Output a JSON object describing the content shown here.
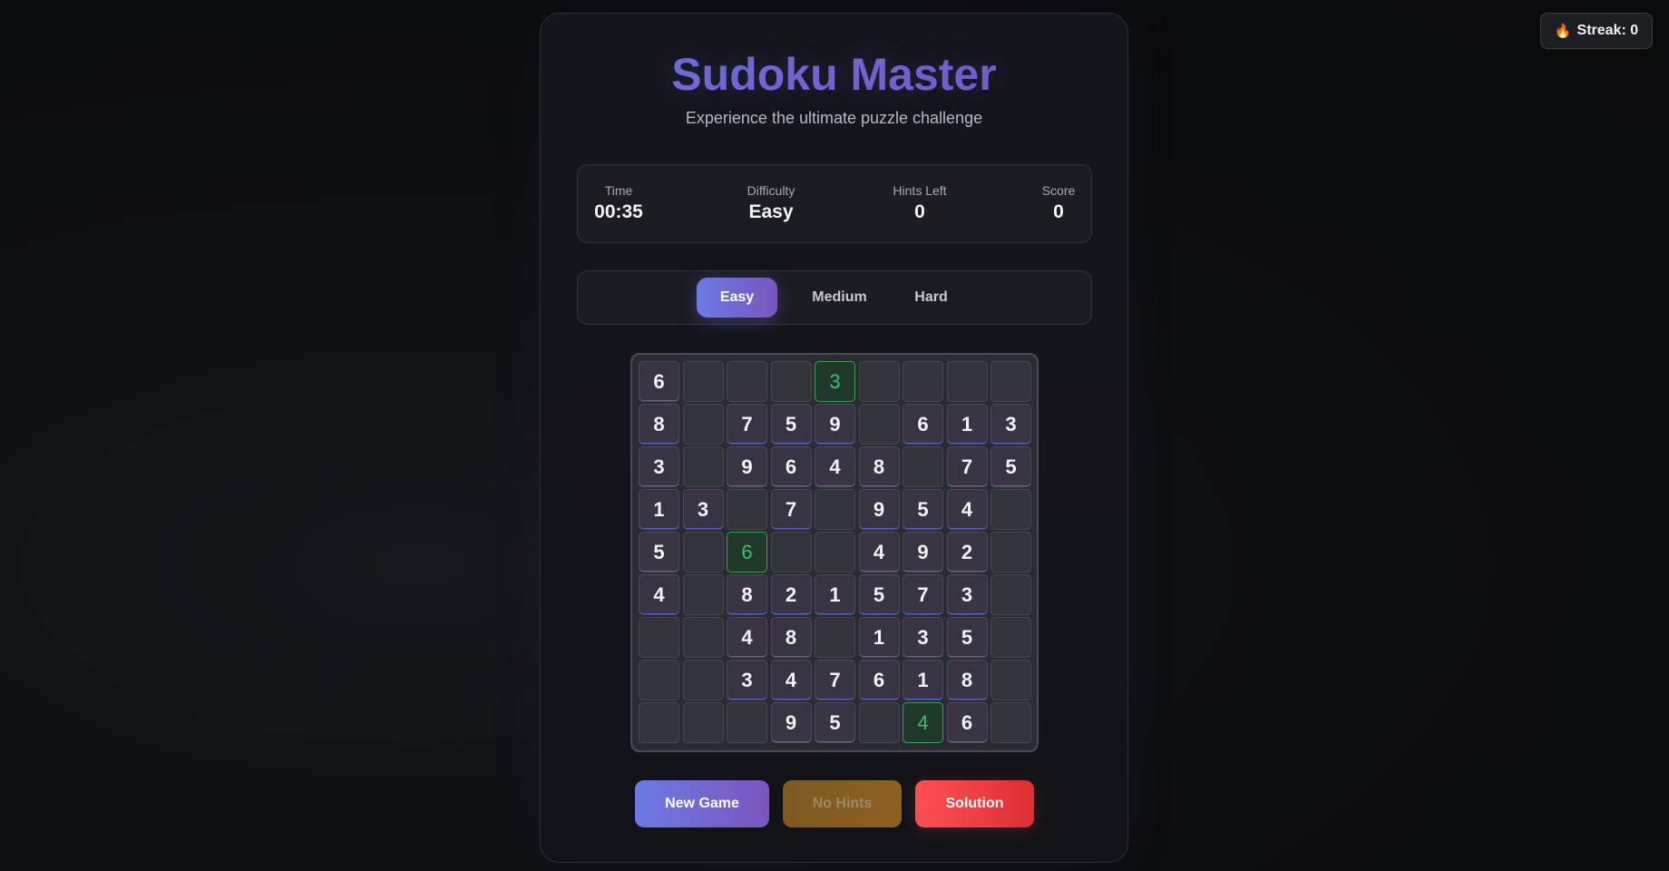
{
  "streak": {
    "icon": "flame-icon",
    "label": "Streak: 0"
  },
  "header": {
    "title": "Sudoku Master",
    "subtitle": "Experience the ultimate puzzle challenge"
  },
  "stats": [
    {
      "label": "Time",
      "value": "00:35"
    },
    {
      "label": "Difficulty",
      "value": "Easy"
    },
    {
      "label": "Hints Left",
      "value": "0"
    },
    {
      "label": "Score",
      "value": "0"
    }
  ],
  "difficulty_options": [
    {
      "label": "Easy",
      "selected": true
    },
    {
      "label": "Medium",
      "selected": false
    },
    {
      "label": "Hard",
      "selected": false
    }
  ],
  "board": {
    "rows": [
      [
        "6",
        "",
        "",
        "",
        "3",
        "",
        "",
        "",
        ""
      ],
      [
        "8",
        "",
        "7",
        "5",
        "9",
        "",
        "6",
        "1",
        "3"
      ],
      [
        "3",
        "",
        "9",
        "6",
        "4",
        "8",
        "",
        "7",
        "5"
      ],
      [
        "1",
        "3",
        "",
        "7",
        "",
        "9",
        "5",
        "4",
        ""
      ],
      [
        "5",
        "",
        "6",
        "",
        "",
        "4",
        "9",
        "2",
        ""
      ],
      [
        "4",
        "",
        "8",
        "2",
        "1",
        "5",
        "7",
        "3",
        ""
      ],
      [
        "",
        "",
        "4",
        "8",
        "",
        "1",
        "3",
        "5",
        ""
      ],
      [
        "",
        "",
        "3",
        "4",
        "7",
        "6",
        "1",
        "8",
        ""
      ],
      [
        "",
        "",
        "",
        "9",
        "5",
        "",
        "4",
        "6",
        ""
      ]
    ],
    "user_entered_cells": [
      [
        0,
        4
      ],
      [
        4,
        2
      ],
      [
        8,
        6
      ]
    ],
    "colors": {
      "given_bg": "#3a3344",
      "empty_bg": "#34353c",
      "user_text": "#3fbf6b"
    }
  },
  "actions": {
    "new_game": "New Game",
    "no_hints": "No Hints",
    "solution": "Solution"
  },
  "colors": {
    "accent": "#6b73e0",
    "danger": "#ff4f55",
    "warning": "#8e6020"
  }
}
